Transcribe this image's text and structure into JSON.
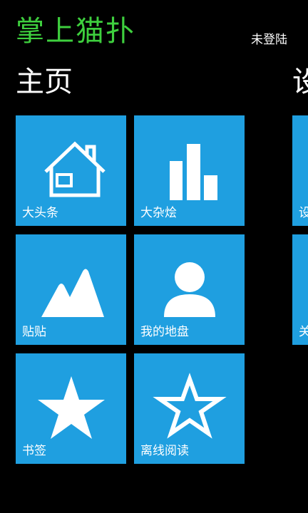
{
  "header": {
    "app_title": "掌上猫扑",
    "login_status": "未登陆"
  },
  "sections": {
    "home_title": "主页",
    "settings_title_partial": "设"
  },
  "tiles": [
    {
      "label": "大头条",
      "icon": "house-icon"
    },
    {
      "label": "大杂烩",
      "icon": "bar-chart-icon"
    },
    {
      "label": "贴贴",
      "icon": "mountains-icon"
    },
    {
      "label": "我的地盘",
      "icon": "user-icon"
    },
    {
      "label": "书签",
      "icon": "star-filled-icon"
    },
    {
      "label": "离线阅读",
      "icon": "star-outline-icon"
    }
  ],
  "peek_tiles": [
    {
      "label": "设"
    },
    {
      "label": "关"
    }
  ],
  "colors": {
    "background": "#000000",
    "tile": "#1f9fe0",
    "app_title": "#3ecf3e"
  }
}
